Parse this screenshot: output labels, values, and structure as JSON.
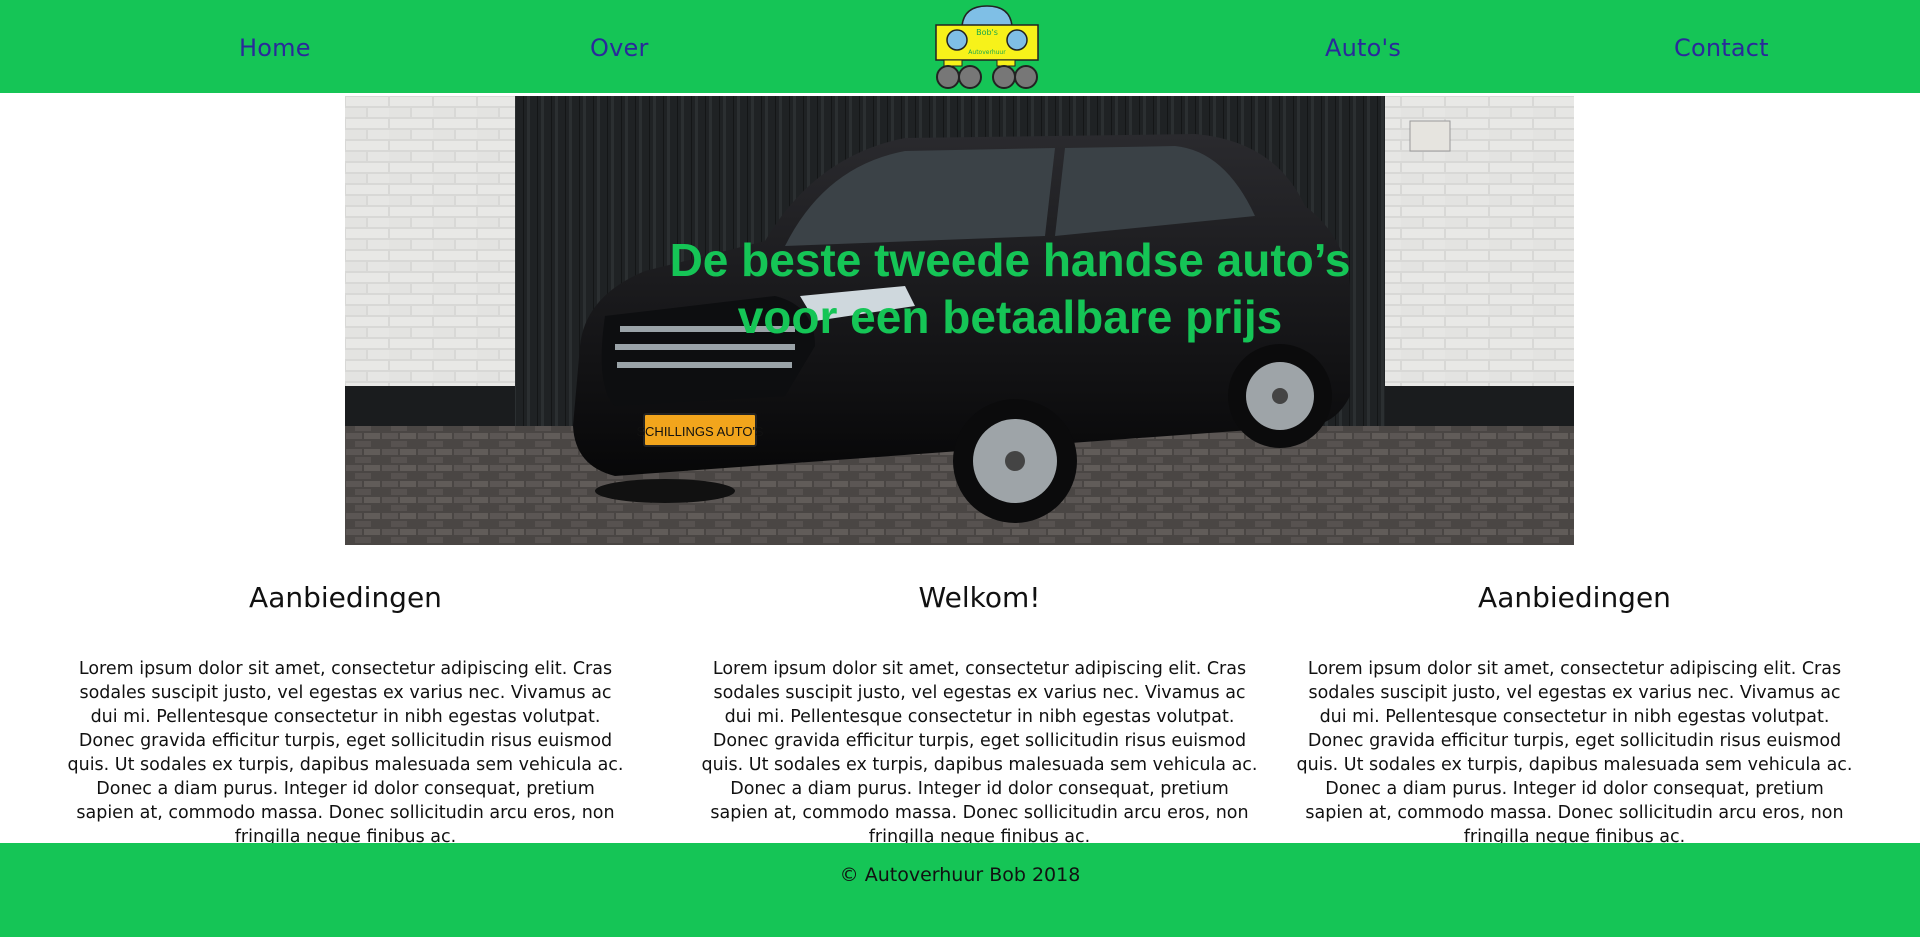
{
  "nav": {
    "home": "Home",
    "over": "Over",
    "autos": "Auto's",
    "contact": "Contact"
  },
  "logo": {
    "line1": "Bob's",
    "line2": "Autoverhuur"
  },
  "hero": {
    "title": "De beste tweede handse auto’s voor een betaalbare prijs",
    "plate": "SCHILLINGS AUTO'S"
  },
  "columns": [
    {
      "heading": "Aanbiedingen",
      "text": "Lorem ipsum dolor sit amet, consectetur adipiscing elit. Cras sodales suscipit justo, vel egestas ex varius nec. Vivamus ac dui mi. Pellentesque consectetur in nibh egestas volutpat. Donec gravida efficitur turpis, eget sollicitudin risus euismod quis. Ut sodales ex turpis, dapibus malesuada sem vehicula ac. Donec a diam purus. Integer id dolor consequat, pretium sapien at, commodo massa. Donec sollicitudin arcu eros, non fringilla neque finibus ac."
    },
    {
      "heading": "Welkom!",
      "text": "Lorem ipsum dolor sit amet, consectetur adipiscing elit. Cras sodales suscipit justo, vel egestas ex varius nec. Vivamus ac dui mi. Pellentesque consectetur in nibh egestas volutpat. Donec gravida efficitur turpis, eget sollicitudin risus euismod quis. Ut sodales ex turpis, dapibus malesuada sem vehicula ac. Donec a diam purus. Integer id dolor consequat, pretium sapien at, commodo massa. Donec sollicitudin arcu eros, non fringilla neque finibus ac."
    },
    {
      "heading": "Aanbiedingen",
      "text": "Lorem ipsum dolor sit amet, consectetur adipiscing elit. Cras sodales suscipit justo, vel egestas ex varius nec. Vivamus ac dui mi. Pellentesque consectetur in nibh egestas volutpat. Donec gravida efficitur turpis, eget sollicitudin risus euismod quis. Ut sodales ex turpis, dapibus malesuada sem vehicula ac. Donec a diam purus. Integer id dolor consequat, pretium sapien at, commodo massa. Donec sollicitudin arcu eros, non fringilla neque finibus ac."
    }
  ],
  "footer": {
    "copyright": "© Autoverhuur Bob 2018"
  },
  "colors": {
    "brand_green": "#15c556",
    "nav_link": "#2a2a9a",
    "logo_yellow": "#f7f21a",
    "logo_blue": "#7fbfe6"
  },
  "icons": {
    "logo": "car-logo-icon",
    "hero": "car-photo"
  }
}
